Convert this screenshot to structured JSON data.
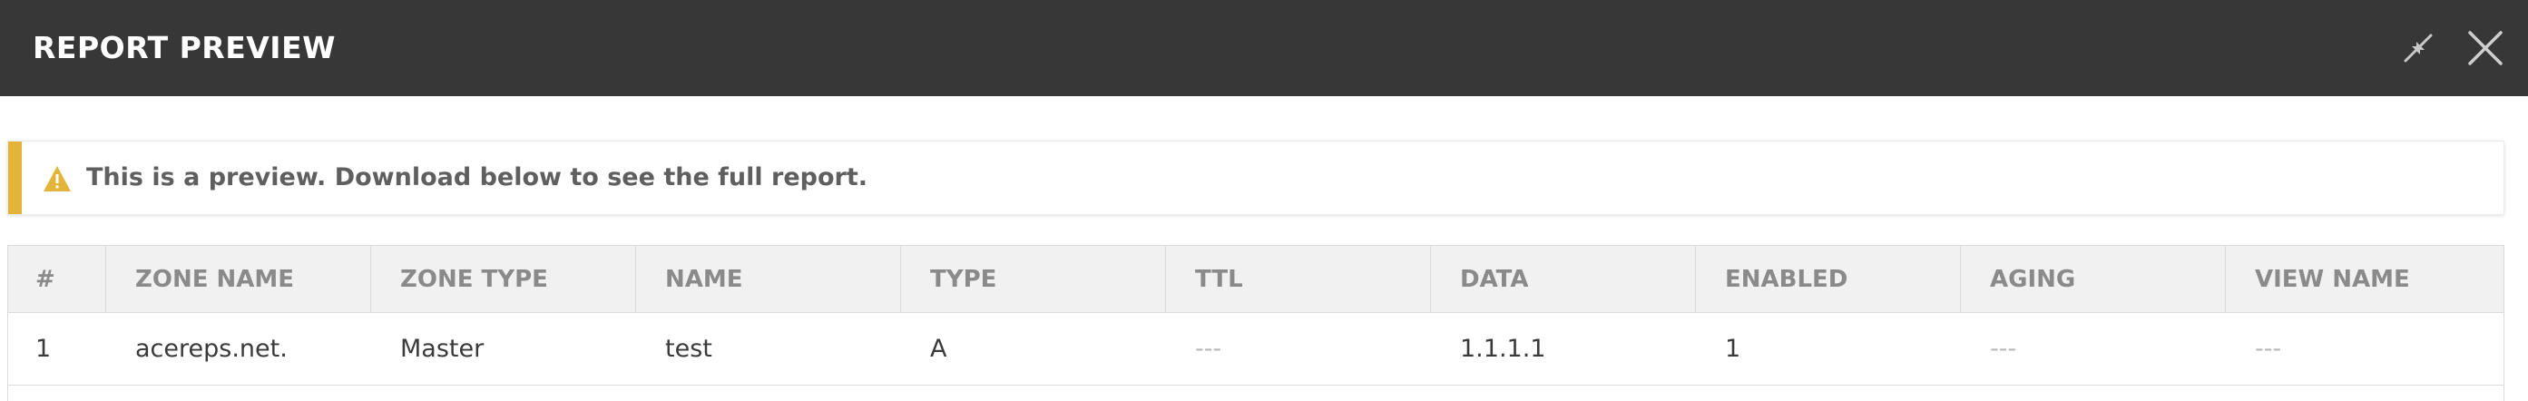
{
  "dialog": {
    "title": "REPORT PREVIEW",
    "header_icons": [
      "collapse-icon",
      "close-icon"
    ]
  },
  "notice": {
    "icon": "warning-icon",
    "message": "This is a preview. Download below to see the full report.",
    "accent_color": "#e2b53a"
  },
  "table": {
    "columns": [
      "#",
      "ZONE NAME",
      "ZONE TYPE",
      "NAME",
      "TYPE",
      "TTL",
      "DATA",
      "ENABLED",
      "AGING",
      "VIEW NAME"
    ],
    "rows": [
      [
        "1",
        "acereps.net.",
        "Master",
        "test",
        "A",
        "---",
        "1.1.1.1",
        "1",
        "---",
        "---"
      ]
    ]
  },
  "colors": {
    "header_bg": "#373737",
    "table_header_bg": "#f1f1f1",
    "warning": "#e2b53a"
  }
}
